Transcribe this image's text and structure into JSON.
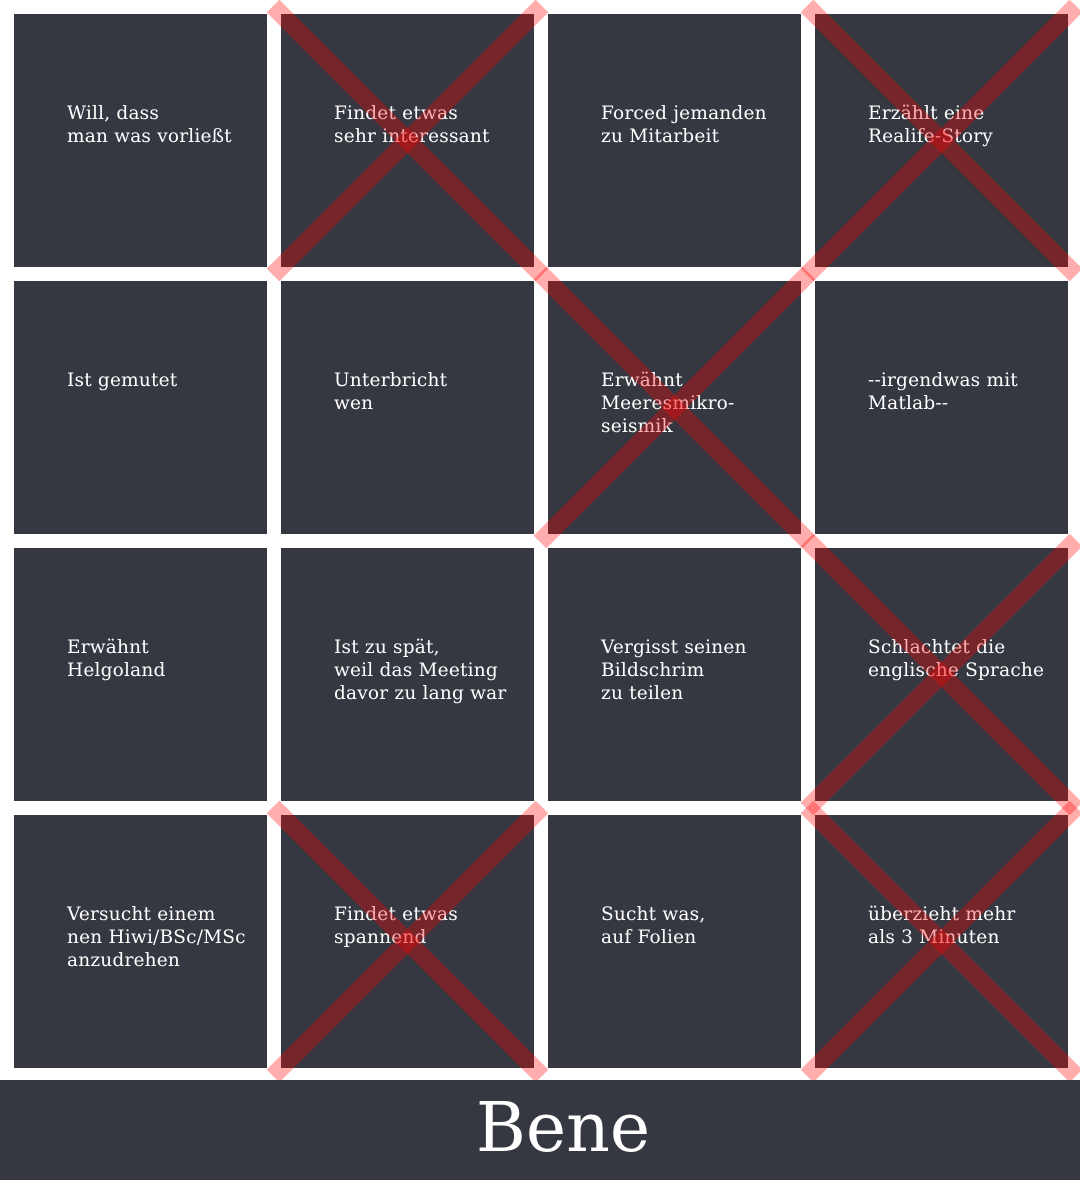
{
  "board": {
    "columns": 4,
    "rows": 4,
    "cell_color": "#353840",
    "cross_color": "#ff0000",
    "cells": [
      {
        "label": "Will, dass\nman was vorließt",
        "marked": false
      },
      {
        "label": "Findet etwas\nsehr interessant",
        "marked": true
      },
      {
        "label": "Forced jemanden\nzu Mitarbeit",
        "marked": false
      },
      {
        "label": "Erzählt eine\nRealife-Story",
        "marked": true
      },
      {
        "label": "Ist gemutet",
        "marked": false
      },
      {
        "label": "Unterbricht\nwen",
        "marked": false
      },
      {
        "label": "Erwähnt\nMeeresmikro-\nseismik",
        "marked": true
      },
      {
        "label": "--irgendwas mit\nMatlab--",
        "marked": false
      },
      {
        "label": "Erwähnt\nHelgoland",
        "marked": false
      },
      {
        "label": "Ist zu spät,\nweil das Meeting\ndavor zu lang war",
        "marked": false
      },
      {
        "label": "Vergisst seinen\nBildschrim\nzu teilen",
        "marked": false
      },
      {
        "label": "Schlachtet die\nenglische Sprache",
        "marked": true
      },
      {
        "label": "Versucht einem\nnen Hiwi/BSc/MSc\nanzudrehen",
        "marked": false
      },
      {
        "label": "Findet etwas\nspannend",
        "marked": true
      },
      {
        "label": "Sucht was,\nauf Folien",
        "marked": false
      },
      {
        "label": "überzieht mehr\nals 3 Minuten",
        "marked": true
      }
    ]
  },
  "footer": {
    "name": "Bene"
  }
}
